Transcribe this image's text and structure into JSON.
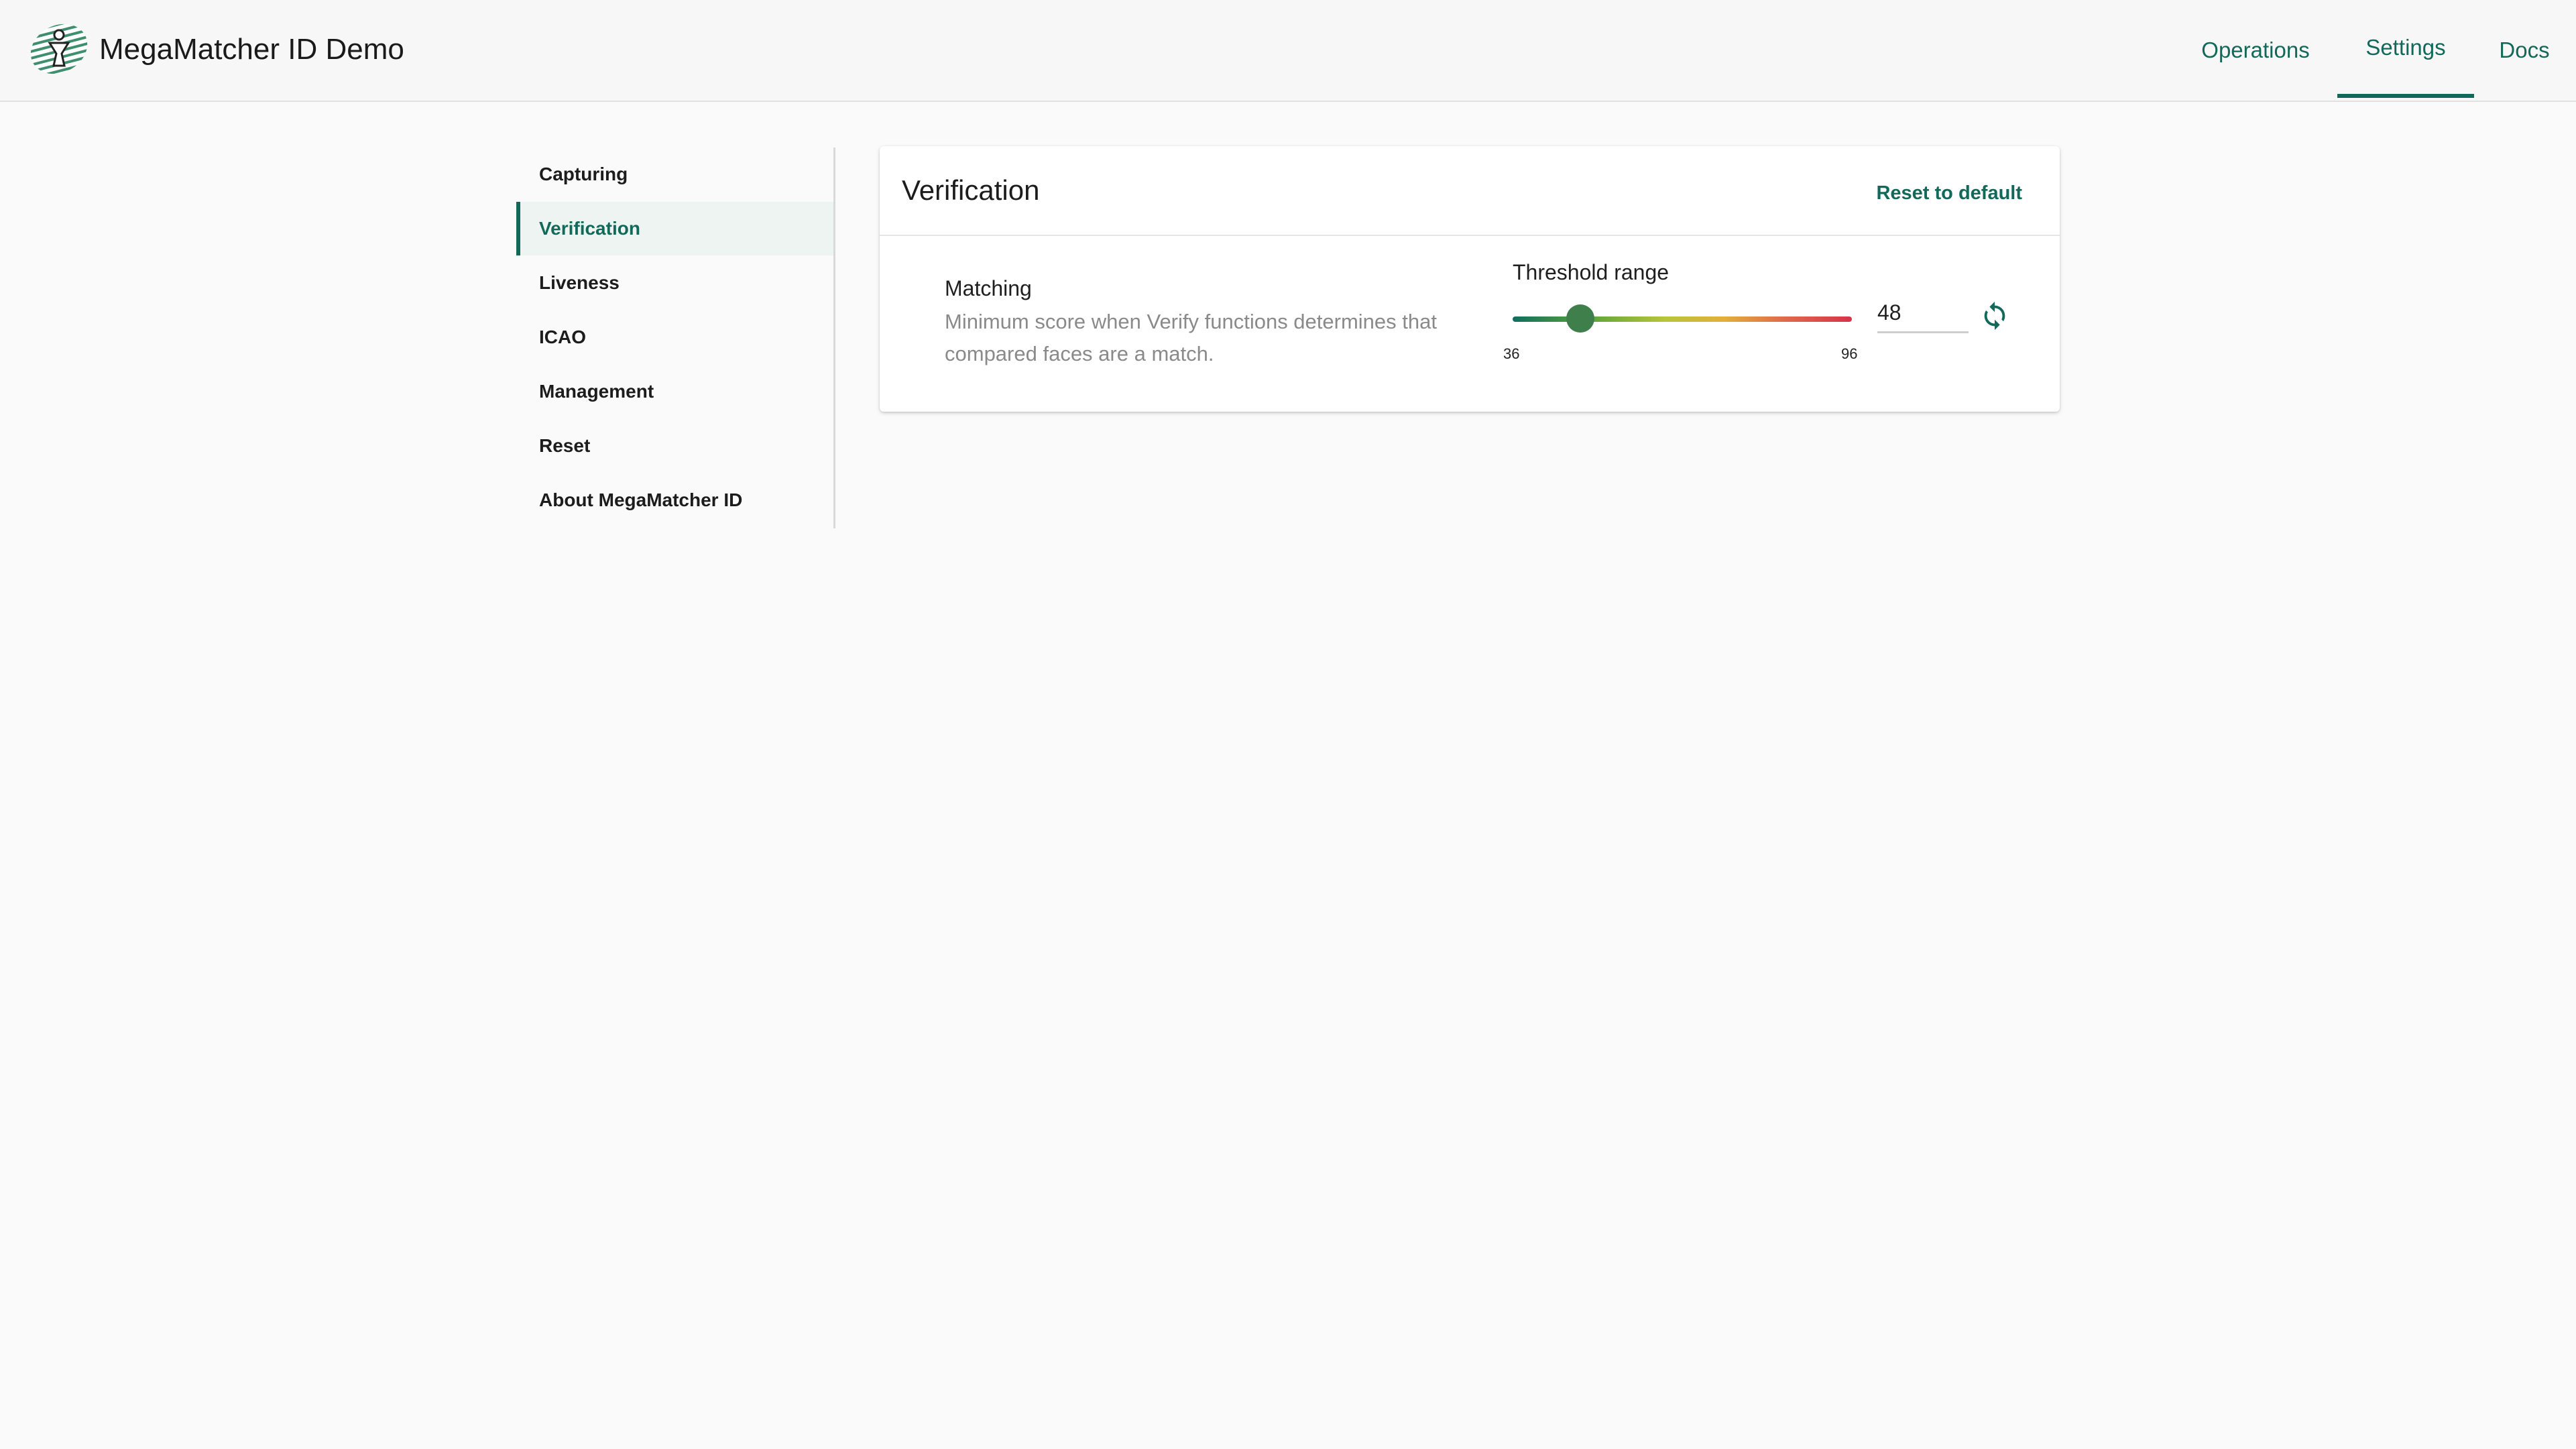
{
  "header": {
    "app_title": "MegaMatcher ID Demo",
    "logo_icon": "megamatcher-logo-icon",
    "nav": [
      {
        "label": "Operations",
        "active": false
      },
      {
        "label": "Settings",
        "active": true
      },
      {
        "label": "Docs",
        "active": false
      }
    ]
  },
  "sidebar": {
    "items": [
      {
        "label": "Capturing",
        "active": false
      },
      {
        "label": "Verification",
        "active": true
      },
      {
        "label": "Liveness",
        "active": false
      },
      {
        "label": "ICAO",
        "active": false
      },
      {
        "label": "Management",
        "active": false
      },
      {
        "label": "Reset",
        "active": false
      },
      {
        "label": "About MegaMatcher ID",
        "active": false
      }
    ]
  },
  "card": {
    "title": "Verification",
    "reset_label": "Reset to default",
    "setting": {
      "title": "Matching",
      "description": "Minimum score when Verify functions determines that compared faces are a match.",
      "threshold_label": "Threshold range",
      "min_label": "36",
      "max_label": "96",
      "min": 36,
      "max": 96,
      "value": "48",
      "refresh_icon": "refresh-icon"
    }
  },
  "colors": {
    "accent": "#12695a",
    "active_bg": "#eef4f2",
    "thumb": "#3f7f4c",
    "description": "#8a8a8a"
  }
}
